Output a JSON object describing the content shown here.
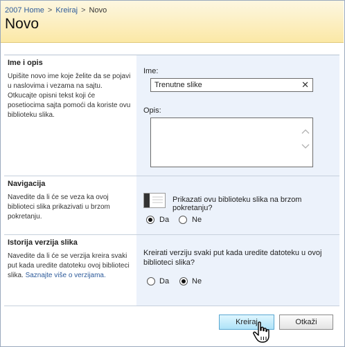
{
  "breadcrumb": {
    "home": "2007 Home",
    "sep": ">",
    "parent": "Kreiraj",
    "current": "Novo"
  },
  "page_title": "Novo",
  "sections": {
    "name": {
      "heading": "Ime i opis",
      "text": "Upišite novo ime koje želite da se pojavi u naslovima i vezama na sajtu. Otkucajte opisni tekst koji će posetiocima sajta pomoći da koriste ovu biblioteku slika.",
      "name_label": "Ime:",
      "name_value": "Trenutne slike",
      "desc_label": "Opis:",
      "desc_value": ""
    },
    "navigation": {
      "heading": "Navigacija",
      "text": "Navedite da li će se veza ka ovoj biblioteci slika prikazivati u brzom pokretanju.",
      "question": "Prikazati ovu biblioteku slika na brzom pokretanju?",
      "options": [
        "Da",
        "Ne"
      ],
      "selected": "Da"
    },
    "versioning": {
      "heading": "Istorija verzija slika",
      "text": "Navedite da li će se verzija kreira svaki put kada uredite datoteku ovoj biblioteci slika.",
      "link": "Saznajte više o verzijama.",
      "question": "Kreirati verziju svaki put kada uredite datoteku u ovoj biblioteci slika?",
      "options": [
        "Da",
        "Ne"
      ],
      "selected": "Ne"
    }
  },
  "buttons": {
    "create": "Kreiraj",
    "cancel": "Otkaži"
  },
  "colors": {
    "header": "#fbe8a6",
    "right_panel": "#ecf2fb",
    "link": "#2c5a9a",
    "primary_button": "#aee3f8"
  }
}
